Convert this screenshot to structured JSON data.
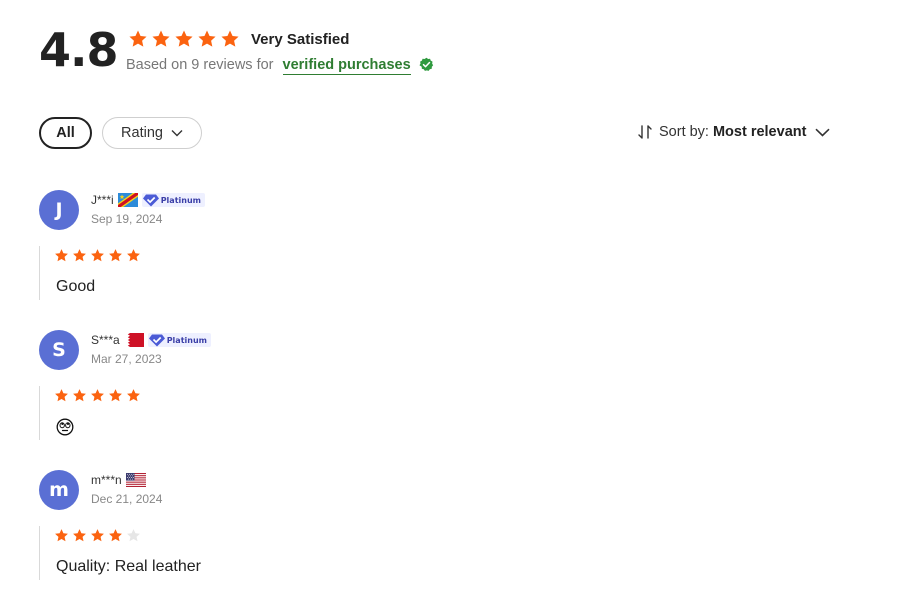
{
  "summary": {
    "score": "4.8",
    "stars": 5,
    "label": "Very Satisfied",
    "based_on": "Based on 9 reviews for",
    "verified_link": "verified purchases",
    "colors": {
      "star": "#fb6310",
      "verified": "#2f7d32"
    }
  },
  "filters": {
    "all_label": "All",
    "rating_label": "Rating"
  },
  "sort": {
    "label": "Sort by:",
    "value": "Most relevant"
  },
  "reviews": [
    {
      "initial": "J",
      "username": "J***i",
      "flag": "dr-congo-flag",
      "badge": "Platinum",
      "date": "Sep 19, 2024",
      "rating": 5,
      "text": "Good"
    },
    {
      "initial": "S",
      "username": "S***a",
      "flag": "bahrain-flag",
      "badge": "Platinum",
      "date": "Mar 27, 2023",
      "rating": 5,
      "text": "",
      "emoji": "rolling-eyes-face-emoji"
    },
    {
      "initial": "m",
      "username": "m***n",
      "flag": "us-flag",
      "badge": "",
      "date": "Dec 21, 2024",
      "rating": 4,
      "text": "Quality: Real leather"
    }
  ]
}
